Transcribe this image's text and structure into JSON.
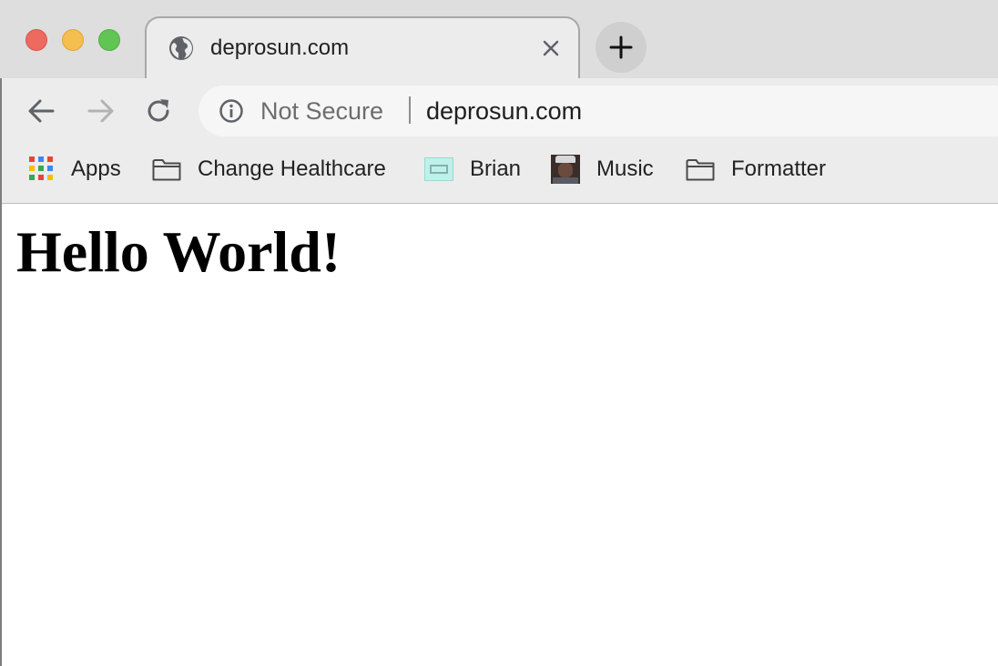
{
  "tab": {
    "title": "deprosun.com",
    "favicon": "globe-icon"
  },
  "toolbar": {
    "back_icon": "arrow-left-icon",
    "forward_icon": "arrow-right-icon",
    "reload_icon": "reload-icon"
  },
  "omnibox": {
    "security_text": "Not Secure",
    "url": "deprosun.com",
    "info_icon": "info-icon"
  },
  "bookmarks": [
    {
      "label": "Apps",
      "icon": "apps-grid-icon"
    },
    {
      "label": "Change Healthcare",
      "icon": "folder-icon"
    },
    {
      "label": "Brian",
      "icon": "brian-favicon"
    },
    {
      "label": "Music",
      "icon": "music-favicon"
    },
    {
      "label": "Formatter",
      "icon": "folder-icon"
    }
  ],
  "page": {
    "heading": "Hello World!"
  },
  "colors": {
    "close": "#ed6a5e",
    "minimize": "#f5bf4f",
    "maximize": "#61c554",
    "apps_grid": [
      "#ea4335",
      "#4285f4",
      "#ea4335",
      "#fbbc05",
      "#34a853",
      "#4285f4",
      "#34a853",
      "#ea4335",
      "#fbbc05"
    ]
  }
}
